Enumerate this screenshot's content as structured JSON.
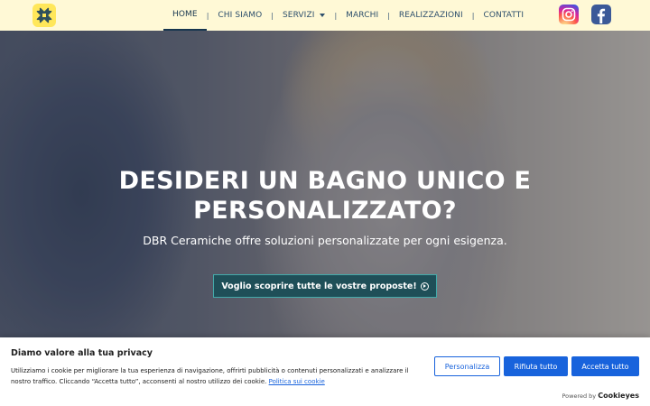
{
  "header": {
    "nav": [
      {
        "label": "HOME",
        "active": true
      },
      {
        "label": "CHI SIAMO"
      },
      {
        "label": "SERVIZI",
        "has_dropdown": true
      },
      {
        "label": "MARCHI"
      },
      {
        "label": "REALIZZAZIONI"
      },
      {
        "label": "CONTATTI"
      }
    ],
    "separator": "|",
    "social": [
      "instagram-icon",
      "facebook-icon"
    ]
  },
  "hero": {
    "title_line1": "DESIDERI UN BAGNO UNICO E",
    "title_line2": "PERSONALIZZATO?",
    "subtitle": "DBR Ceramiche offre soluzioni personalizzate per ogni esigenza.",
    "cta_label": "Voglio scoprire tutte le vostre proposte!",
    "cta_icon": "arrow-circle-right-icon"
  },
  "cookie_banner": {
    "title": "Diamo valore alla tua privacy",
    "text": "Utilizziamo i cookie per migliorare la tua esperienza di navigazione, offrirti pubblicità o contenuti personalizzati e analizzare il nostro traffico. Cliccando “Accetta tutto”, acconsenti al nostro utilizzo dei cookie.",
    "policy_link": "Politica sui cookie",
    "customize_label": "Personalizza",
    "reject_label": "Rifiuta tutto",
    "accept_label": "Accetta tutto",
    "powered_by": "Powered by",
    "powered_brand": "Cookieyes"
  },
  "colors": {
    "header_bg": "#fff9d6",
    "nav_text": "#2d4f6c",
    "cta_bg": "#1f4f58",
    "cookie_accent": "#1863dc"
  }
}
